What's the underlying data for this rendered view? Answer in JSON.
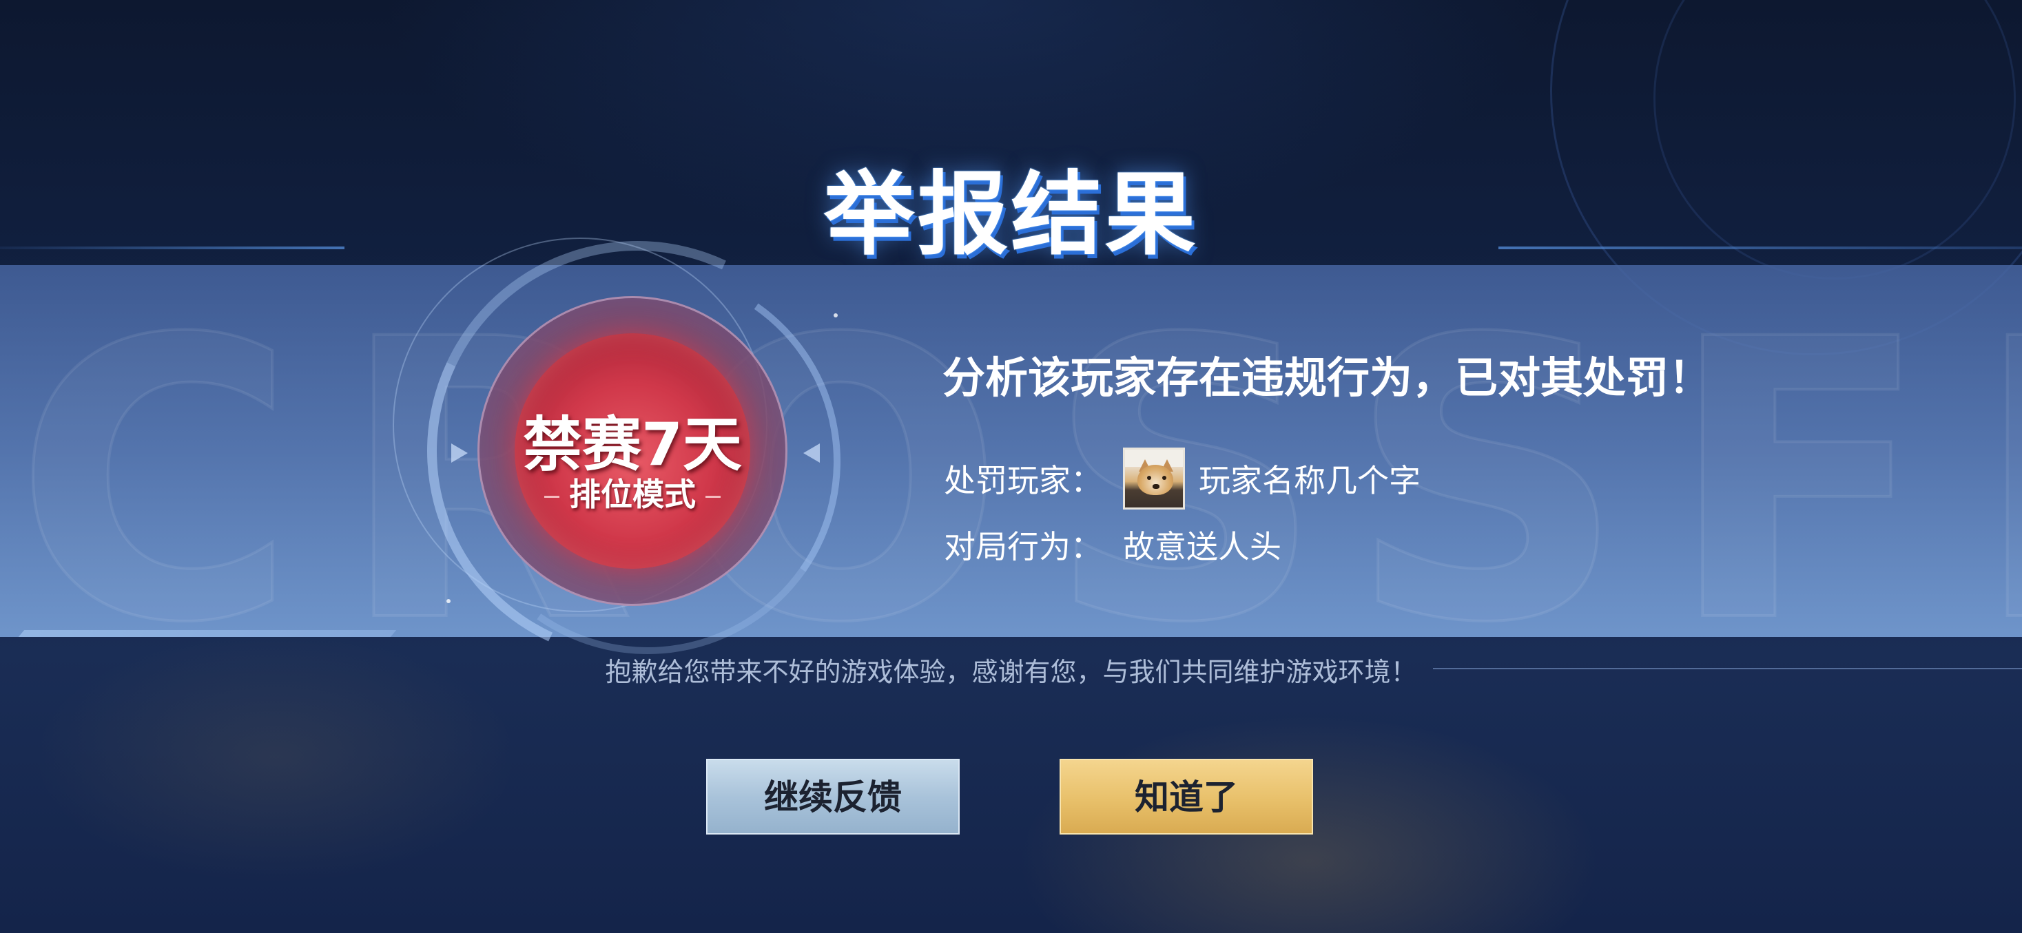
{
  "title": "举报结果",
  "background_word": "CROSSFIRE",
  "penalty": {
    "duration": "禁赛7天",
    "mode": "排位模式"
  },
  "verdict": "分析该玩家存在违规行为，已对其处罚！",
  "details": {
    "player_label": "处罚玩家：",
    "player_name": "玩家名称几个字",
    "avatar": "shiba-dog-avatar",
    "behavior_label": "对局行为：",
    "behavior_value": "故意送人头"
  },
  "apology": "抱歉给您带来不好的游戏体验，感谢有您，与我们共同维护游戏环境！",
  "buttons": {
    "continue_label": "继续反馈",
    "ok_label": "知道了"
  },
  "colors": {
    "title_glow": "#2b6fd8",
    "penalty_red": "#d0384a",
    "continue_button": "#a9c3da",
    "ok_button": "#e8c06a"
  }
}
